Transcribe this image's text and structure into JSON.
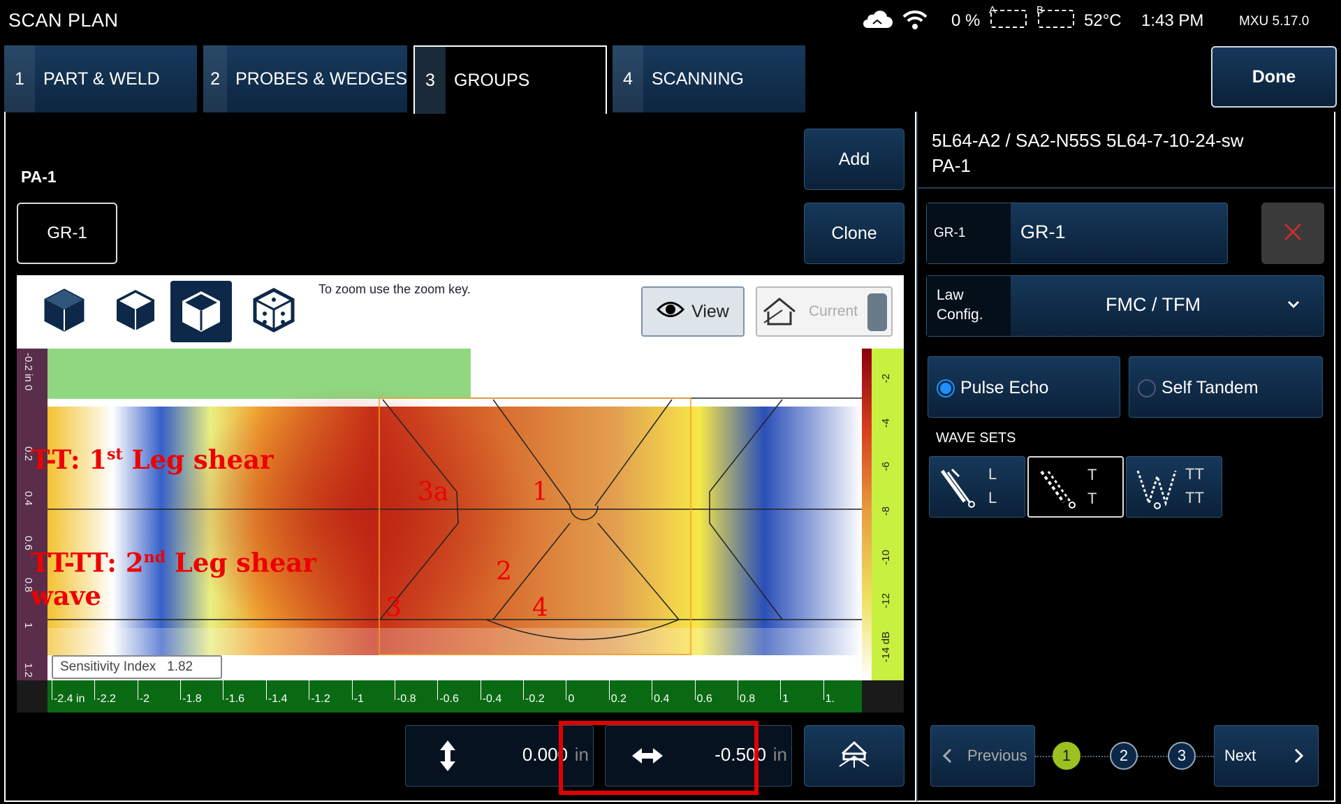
{
  "app": {
    "title": "SCAN PLAN"
  },
  "status": {
    "cloud_icon": "cloud-icon",
    "wifi_icon": "wifi-icon",
    "storage": "0 %",
    "battery_a_label": "A",
    "battery_b_label": "B",
    "temperature": "52°C",
    "time": "1:43 PM",
    "version": "MXU  5.17.0"
  },
  "tabs": [
    {
      "num": "1",
      "label": "PART & WELD"
    },
    {
      "num": "2",
      "label": "PROBES & WEDGES"
    },
    {
      "num": "3",
      "label": "GROUPS"
    },
    {
      "num": "4",
      "label": "SCANNING"
    }
  ],
  "toolbar": {
    "done": "Done",
    "add": "Add",
    "clone": "Clone"
  },
  "group": {
    "probe_name": "PA-1",
    "selected": "GR-1"
  },
  "viewer": {
    "zoom_hint": "To zoom use the zoom key.",
    "view_label": "View",
    "current_label": "Current",
    "sensitivity_label": "Sensitivity Index",
    "sensitivity_value": "1.82",
    "annotation_1_a": "T-T: 1",
    "annotation_1_sup": "st",
    "annotation_1_b": " Leg shear",
    "annotation_2_a": "TT-TT: 2",
    "annotation_2_sup": "nd",
    "annotation_2_b": " Leg shear",
    "annotation_2_c": "wave",
    "zones": [
      "3a",
      "1",
      "2",
      "3",
      "4"
    ],
    "left_axis_ticks": [
      "-0.2 in 0",
      "0.2",
      "0.4",
      "0.6",
      "0.8",
      "1",
      "1.2"
    ],
    "right_scale_ticks": [
      "-2",
      "-4",
      "-6",
      "-8",
      "-10",
      "-12",
      "-14 dB"
    ],
    "x_ticks": [
      "-2.4 in",
      "-2.2",
      "-2",
      "-1.8",
      "-1.6",
      "-1.4",
      "-1.2",
      "-1",
      "-0.8",
      "-0.6",
      "-0.4",
      "-0.2",
      "0",
      "0.2",
      "0.4",
      "0.6",
      "0.8",
      "1",
      "1."
    ]
  },
  "position": {
    "vertical_value": "0.000",
    "vertical_unit": "in",
    "horizontal_value": "-0.500",
    "horizontal_unit": "in"
  },
  "right": {
    "header_line1": "5L64-A2 / SA2-N55S 5L64-7-10-24-sw",
    "header_line2": "PA-1",
    "group_field_label": "GR-1",
    "group_field_value": "GR-1",
    "law_label_1": "Law",
    "law_label_2": "Config.",
    "law_value": "FMC / TFM",
    "pulse_echo": "Pulse Echo",
    "self_tandem": "Self Tandem",
    "wave_sets_title": "WAVE SETS",
    "wave_sets": [
      {
        "l1": "L",
        "l2": "L",
        "icon": "longitudinal-wave-icon"
      },
      {
        "l1": "T",
        "l2": "T",
        "icon": "transverse-wave-icon"
      },
      {
        "l1": "TT",
        "l2": "TT",
        "icon": "double-transverse-wave-icon"
      }
    ],
    "previous": "Previous",
    "next": "Next",
    "pages": [
      "1",
      "2",
      "3"
    ]
  },
  "colors": {
    "accent_active_page": "#9bc220",
    "highlight_box": "#e00000",
    "radio_selected": "#1e90ff"
  }
}
